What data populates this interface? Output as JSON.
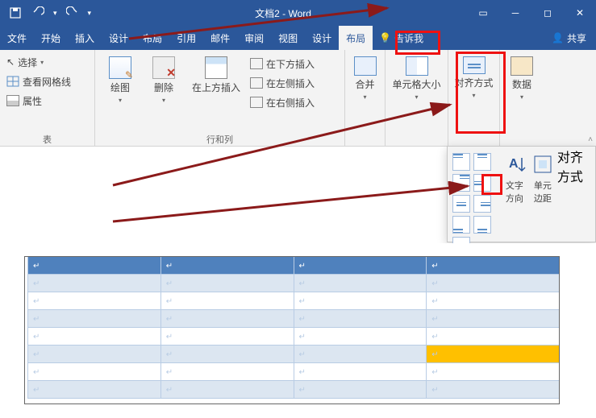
{
  "titlebar": {
    "title": "文档2 - Word",
    "qat_save": "保存",
    "qat_undo": "撤销",
    "qat_redo": "重做"
  },
  "winbtns": {
    "min": "─",
    "max": "◻",
    "close": "✕",
    "ribbonopts": "▭"
  },
  "tabs": {
    "file": "文件",
    "home": "开始",
    "insert": "插入",
    "design": "设计",
    "layout": "布局",
    "references": "引用",
    "mailings": "邮件",
    "review": "审阅",
    "view": "视图",
    "design2": "设计",
    "layout2": "布局",
    "tellme": "告诉我",
    "share": "共享"
  },
  "ribbon": {
    "table_group": {
      "select": "选择",
      "gridlines": "查看网格线",
      "properties": "属性",
      "label": "表"
    },
    "draw_group": {
      "draw": "绘图",
      "delete": "删除",
      "insert_above": "在上方插入",
      "insert_below": "在下方插入",
      "insert_left": "在左侧插入",
      "insert_right": "在右侧插入",
      "label": "行和列"
    },
    "merge": "合并",
    "cellsize": "单元格大小",
    "align": "对齐方式",
    "data": "数据"
  },
  "align_popup": {
    "text_direction": "文字方向",
    "cell_margins": "单元\n边距",
    "label": "对齐方式"
  },
  "paragraph_mark": "↵"
}
